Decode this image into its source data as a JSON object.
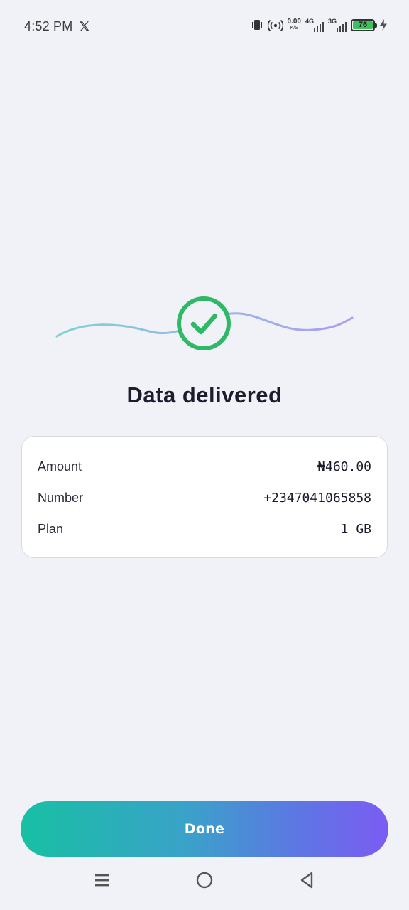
{
  "status_bar": {
    "time": "4:52 PM",
    "net_speed_value": "0.00",
    "net_speed_unit": "K/S",
    "network_1": "4G",
    "network_2": "3G",
    "battery_level": "76"
  },
  "main": {
    "title": "Data delivered",
    "details": [
      {
        "label": "Amount",
        "value": "₦460.00"
      },
      {
        "label": "Number",
        "value": "+2347041065858"
      },
      {
        "label": "Plan",
        "value": "1 GB"
      }
    ]
  },
  "actions": {
    "done_label": "Done"
  },
  "colors": {
    "success": "#2fb865",
    "gradient_start": "#17c0a3",
    "gradient_end": "#7b5cf3",
    "background": "#f0f2f7"
  },
  "icons": {
    "status": [
      "x-logo-icon",
      "vibrate-icon",
      "hotspot-icon",
      "signal-icon",
      "battery-icon",
      "charging-icon"
    ],
    "hero": "checkmark-circle-icon",
    "nav": [
      "menu-icon",
      "home-icon",
      "back-icon"
    ]
  }
}
